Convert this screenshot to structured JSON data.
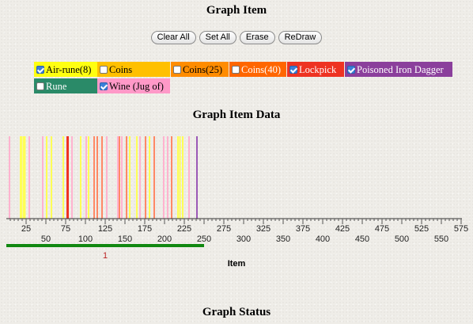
{
  "sections": {
    "graph_item_title": "Graph Item",
    "graph_item_data_title": "Graph Item Data",
    "graph_status_title": "Graph Status"
  },
  "buttons": {
    "clear_all": "Clear All",
    "set_all": "Set All",
    "erase": "Erase",
    "redraw": "ReDraw"
  },
  "legend": [
    {
      "label": "Air-rune(8)",
      "checked": true,
      "color": "#ffff11",
      "text_color": "#000000"
    },
    {
      "label": "Coins",
      "checked": false,
      "color": "#ffc000",
      "text_color": "#000000"
    },
    {
      "label": "Coins(25)",
      "checked": false,
      "color": "#ff8c00",
      "text_color": "#000000"
    },
    {
      "label": "Coins(40)",
      "checked": false,
      "color": "#ff6600",
      "text_color": "#ffffff"
    },
    {
      "label": "Lockpick",
      "checked": true,
      "color": "#ee3322",
      "text_color": "#ffffff"
    },
    {
      "label": "Poisoned Iron Dagger",
      "checked": true,
      "color": "#8b3f9c",
      "text_color": "#ffffff"
    },
    {
      "label": "Rune",
      "checked": false,
      "color": "#2a8a68",
      "text_color": "#ffffff"
    },
    {
      "label": "Wine (Jug of)",
      "checked": true,
      "color": "#ff99c8",
      "text_color": "#000000"
    }
  ],
  "chart_data": {
    "type": "bar",
    "xlabel": "Item",
    "xlim": [
      0,
      575
    ],
    "ticks_upper": [
      25,
      75,
      125,
      175,
      225,
      275,
      325,
      375,
      425,
      475,
      525,
      575
    ],
    "ticks_lower": [
      50,
      100,
      150,
      200,
      250,
      300,
      350,
      400,
      450,
      500,
      550
    ],
    "range_bar": {
      "from": 0,
      "to": 250,
      "color": "#118811"
    },
    "page_label": "1",
    "marks": [
      {
        "x": 3,
        "series": "Wine (Jug of)",
        "color": "#ffb3cf"
      },
      {
        "x": 17,
        "series": "Air-rune(8)",
        "color": "#ffff55"
      },
      {
        "x": 18.5,
        "series": "Air-rune(8)",
        "color": "#ffff55"
      },
      {
        "x": 21,
        "series": "Air-rune(8)",
        "color": "#ffff55"
      },
      {
        "x": 22.5,
        "series": "Air-rune(8)",
        "color": "#ffff55"
      },
      {
        "x": 28,
        "series": "Wine (Jug of)",
        "color": "#ffb3cf"
      },
      {
        "x": 45,
        "series": "Wine (Jug of)",
        "color": "#ffb3cf"
      },
      {
        "x": 50,
        "series": "Air-rune(8)",
        "color": "#ffff55"
      },
      {
        "x": 56,
        "series": "Air-rune(8)",
        "color": "#ffff55"
      },
      {
        "x": 71,
        "series": "Air-rune(8)",
        "color": "#ffff55"
      },
      {
        "x": 76,
        "series": "Lockpick",
        "color": "#ee3322"
      },
      {
        "x": 77,
        "series": "Lockpick",
        "color": "#ee3322"
      },
      {
        "x": 82,
        "series": "Wine (Jug of)",
        "color": "#ffb3cf"
      },
      {
        "x": 93,
        "series": "Air-rune(8)",
        "color": "#ffff55"
      },
      {
        "x": 100,
        "series": "Wine (Jug of)",
        "color": "#ffb3cf"
      },
      {
        "x": 103,
        "series": "Air-rune(8)",
        "color": "#ffff55"
      },
      {
        "x": 110,
        "series": "Lockpick",
        "color": "#ff8866"
      },
      {
        "x": 114,
        "series": "Lockpick",
        "color": "#ff8866"
      },
      {
        "x": 120,
        "series": "Lockpick",
        "color": "#ff8866"
      },
      {
        "x": 126,
        "series": "Wine (Jug of)",
        "color": "#ffb3cf"
      },
      {
        "x": 140,
        "series": "Wine (Jug of)",
        "color": "#ffb3cf"
      },
      {
        "x": 142,
        "series": "Lockpick",
        "color": "#ff8866"
      },
      {
        "x": 145,
        "series": "Wine (Jug of)",
        "color": "#ffb3cf"
      },
      {
        "x": 151,
        "series": "Lockpick",
        "color": "#ff8866"
      },
      {
        "x": 155,
        "series": "Air-rune(8)",
        "color": "#ffff55"
      },
      {
        "x": 164,
        "series": "Air-rune(8)",
        "color": "#ffff55"
      },
      {
        "x": 168,
        "series": "Wine (Jug of)",
        "color": "#ffb3cf"
      },
      {
        "x": 175,
        "series": "Lockpick",
        "color": "#ff8866"
      },
      {
        "x": 180,
        "series": "Air-rune(8)",
        "color": "#ffff55"
      },
      {
        "x": 186,
        "series": "Lockpick",
        "color": "#ff8866"
      },
      {
        "x": 198,
        "series": "Wine (Jug of)",
        "color": "#ffb3cf"
      },
      {
        "x": 203,
        "series": "Wine (Jug of)",
        "color": "#ffb3cf"
      },
      {
        "x": 208,
        "series": "Lockpick",
        "color": "#ff8866"
      },
      {
        "x": 216,
        "series": "Air-rune(8)",
        "color": "#ffff55"
      },
      {
        "x": 218.5,
        "series": "Air-rune(8)",
        "color": "#ffff55"
      },
      {
        "x": 222,
        "series": "Air-rune(8)",
        "color": "#ffff55"
      },
      {
        "x": 230,
        "series": "Wine (Jug of)",
        "color": "#ffb3cf"
      },
      {
        "x": 240,
        "series": "Poisoned Iron Dagger",
        "color": "#9b59b6"
      }
    ]
  }
}
